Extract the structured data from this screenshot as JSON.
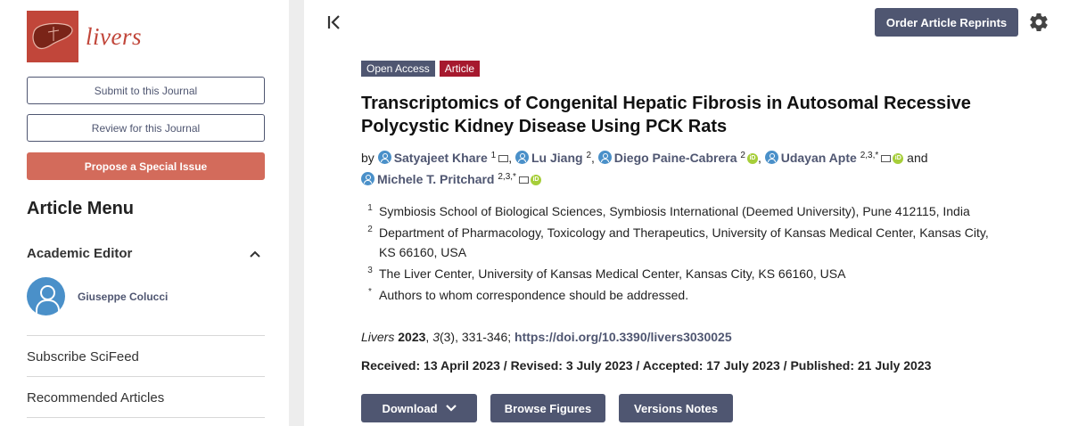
{
  "journal": {
    "name": "livers"
  },
  "sidebar": {
    "submit_label": "Submit to this Journal",
    "review_label": "Review for this Journal",
    "propose_label": "Propose a Special Issue",
    "menu_title": "Article Menu",
    "editor_section_title": "Academic Editor",
    "editor_name": "Giuseppe Colucci",
    "links": [
      "Subscribe SciFeed",
      "Recommended Articles"
    ]
  },
  "header": {
    "reprints_label": "Order Article Reprints"
  },
  "article": {
    "tags": [
      "Open Access",
      "Article"
    ],
    "title_line1": "Transcriptomics of Congenital Hepatic Fibrosis in Autosomal Recessive",
    "title_line2": "Polycystic Kidney Disease Using PCK Rats",
    "by": "by",
    "and": "and",
    "authors": [
      {
        "name": "Satyajeet Khare",
        "sup": "1"
      },
      {
        "name": "Lu Jiang",
        "sup": "2"
      },
      {
        "name": "Diego Paine-Cabrera",
        "sup": "2"
      },
      {
        "name": "Udayan Apte",
        "sup": "2,3,*"
      },
      {
        "name": "Michele T. Pritchard",
        "sup": "2,3,*"
      }
    ],
    "affiliations": [
      {
        "num": "1",
        "text": "Symbiosis School of Biological Sciences, Symbiosis International (Deemed University), Pune 412115, India"
      },
      {
        "num": "2",
        "text": "Department of Pharmacology, Toxicology and Therapeutics, University of Kansas Medical Center, Kansas City, KS 66160, USA"
      },
      {
        "num": "3",
        "text": "The Liver Center, University of Kansas Medical Center, Kansas City, KS 66160, USA"
      },
      {
        "num": "*",
        "text": "Authors to whom correspondence should be addressed."
      }
    ],
    "citation": {
      "journal": "Livers",
      "year": "2023",
      "volume": "3",
      "rest": "(3), 331-346; ",
      "doi": "https://doi.org/10.3390/livers3030025"
    },
    "dates": "Received: 13 April 2023 / Revised: 3 July 2023 / Accepted: 17 July 2023 / Published: 21 July 2023",
    "actions": {
      "download": "Download",
      "figures": "Browse Figures",
      "versions": "Versions Notes"
    }
  },
  "colors": {
    "brand": "#c1463a",
    "navy": "#4f5671",
    "article_tag": "#a6192e",
    "orcid": "#a6ce39"
  },
  "icons": [
    "collapse-sidebar-icon",
    "gear-icon",
    "author-icon",
    "mail-icon",
    "orcid-icon",
    "chevron-up-icon",
    "chevron-down-icon",
    "liver-logo"
  ]
}
